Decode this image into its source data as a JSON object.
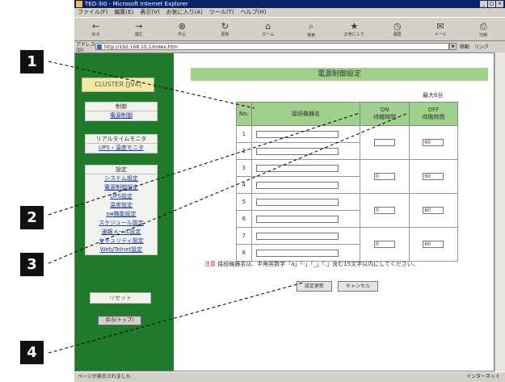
{
  "window": {
    "title": "TED-3I0 - Microsoft Internet Explorer",
    "controls": [
      "_",
      "□",
      "×"
    ]
  },
  "menu": [
    "ファイル(F)",
    "編集(E)",
    "表示(V)",
    "お気に入り(A)",
    "ツール(T)",
    "ヘルプ(H)"
  ],
  "toolbar": [
    {
      "icon": "back-icon",
      "glyph": "←",
      "label": "戻る"
    },
    {
      "icon": "forward-icon",
      "glyph": "→",
      "label": "進む"
    },
    {
      "icon": "stop-icon",
      "glyph": "⊗",
      "label": "中止"
    },
    {
      "icon": "refresh-icon",
      "glyph": "↻",
      "label": "更新"
    },
    {
      "icon": "home-icon",
      "glyph": "⌂",
      "label": "ホーム"
    },
    {
      "icon": "search-icon",
      "glyph": "⌕",
      "label": "検索"
    },
    {
      "icon": "favorites-icon",
      "glyph": "★",
      "label": "お気に入り"
    },
    {
      "icon": "history-icon",
      "glyph": "◷",
      "label": "履歴"
    },
    {
      "icon": "mail-icon",
      "glyph": "✉",
      "label": "メール"
    },
    {
      "icon": "print-icon",
      "glyph": "⎙",
      "label": "印刷"
    }
  ],
  "address": {
    "label": "アドレス(D)",
    "url": "http://192.168.10.1/index.htm",
    "go": "移動",
    "links": "リンク"
  },
  "sidebar": {
    "cluster": "CLUSTER [JV4]",
    "groups": [
      {
        "header": "制御",
        "items": [
          "電源制御"
        ]
      },
      {
        "header": "リアルタイムモニタ",
        "items": [
          "UPS・温度モニタ"
        ]
      },
      {
        "header": "設定",
        "items": [
          "システム設定",
          "電源制御設定",
          "UPS設定",
          "温度設定",
          "sw機能設定",
          "スケジュール設定",
          "通報メール設定",
          "セキュリティ設定",
          "Web/Telnet設定"
        ]
      }
    ],
    "reset": "リセット",
    "small_button": "戻る(トップ)"
  },
  "main": {
    "title": "電源制御設定",
    "max_note": "最大6台",
    "headers": {
      "no": "No.",
      "name": "接続機器名",
      "on": "ON\n待機時間",
      "off": "OFF\n待機時間"
    },
    "rows": [
      {
        "no": "1",
        "name": ""
      },
      {
        "no": "2",
        "name": ""
      },
      {
        "no": "3",
        "name": ""
      },
      {
        "no": "4",
        "name": ""
      },
      {
        "no": "5",
        "name": ""
      },
      {
        "no": "6",
        "name": ""
      },
      {
        "no": "7",
        "name": ""
      },
      {
        "no": "8",
        "name": ""
      }
    ],
    "pairs": [
      {
        "on": "",
        "off": "60"
      },
      {
        "on": "0",
        "off": "60"
      },
      {
        "on": "0",
        "off": "60"
      },
      {
        "on": "0",
        "off": "60"
      }
    ],
    "note_prefix": "注意",
    "note_text": "接続機器名は、半角英数字「a」「-」「_」「.」含む15文字以内にしてください。",
    "buttons": {
      "submit": "設定更新",
      "cancel": "キャンセル"
    }
  },
  "status": {
    "left": "ページが表示されました",
    "right": "インターネット"
  },
  "callouts": [
    "1",
    "2",
    "3",
    "4"
  ]
}
